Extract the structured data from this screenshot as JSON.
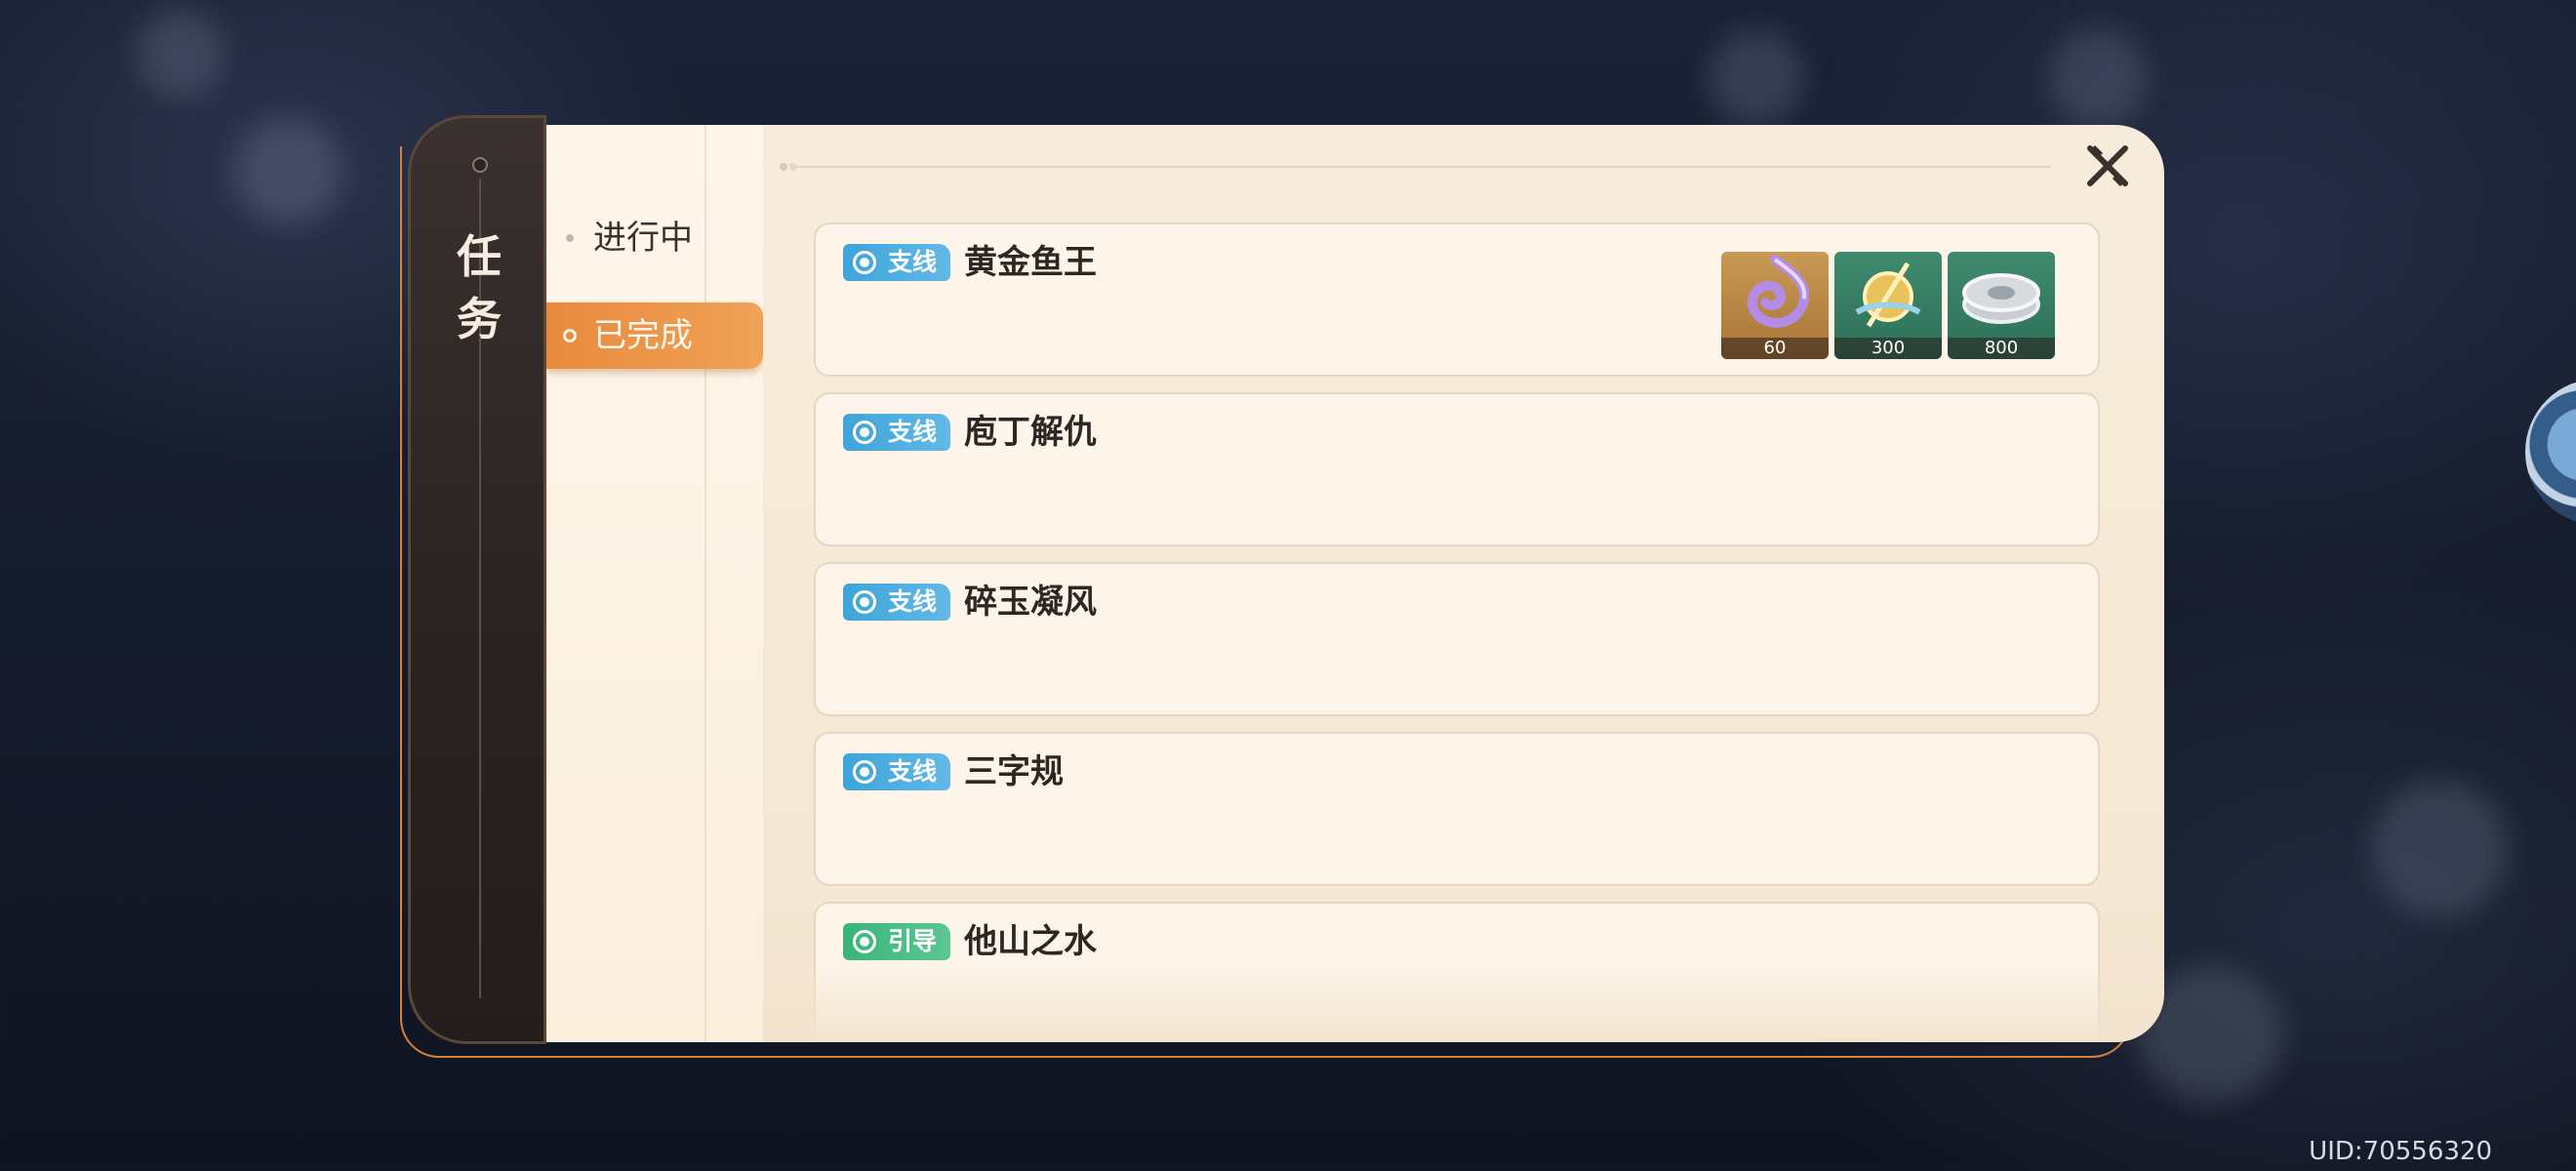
{
  "sidebar": {
    "title": "任务"
  },
  "nav": {
    "items": [
      {
        "label": "进行中"
      },
      {
        "label": "已完成"
      }
    ]
  },
  "quests": [
    {
      "tag": "支线",
      "name": "黄金鱼王",
      "rewards": [
        {
          "icon": "primogem-icon",
          "count": "60"
        },
        {
          "icon": "hero-wit-icon",
          "count": "300"
        },
        {
          "icon": "mora-icon",
          "count": "800"
        }
      ]
    },
    {
      "tag": "支线",
      "name": "庖丁解仇"
    },
    {
      "tag": "支线",
      "name": "碎玉凝风"
    },
    {
      "tag": "支线",
      "name": "三字规"
    },
    {
      "tag": "引导",
      "name": "他山之水"
    }
  ],
  "footer": {
    "uid": "UID:70556320"
  },
  "colors": {
    "accent": "#e88a3d",
    "side_tag": "#3ea4da",
    "guide_tag": "#39b57a",
    "panel_bg": "#f7ecdc"
  }
}
